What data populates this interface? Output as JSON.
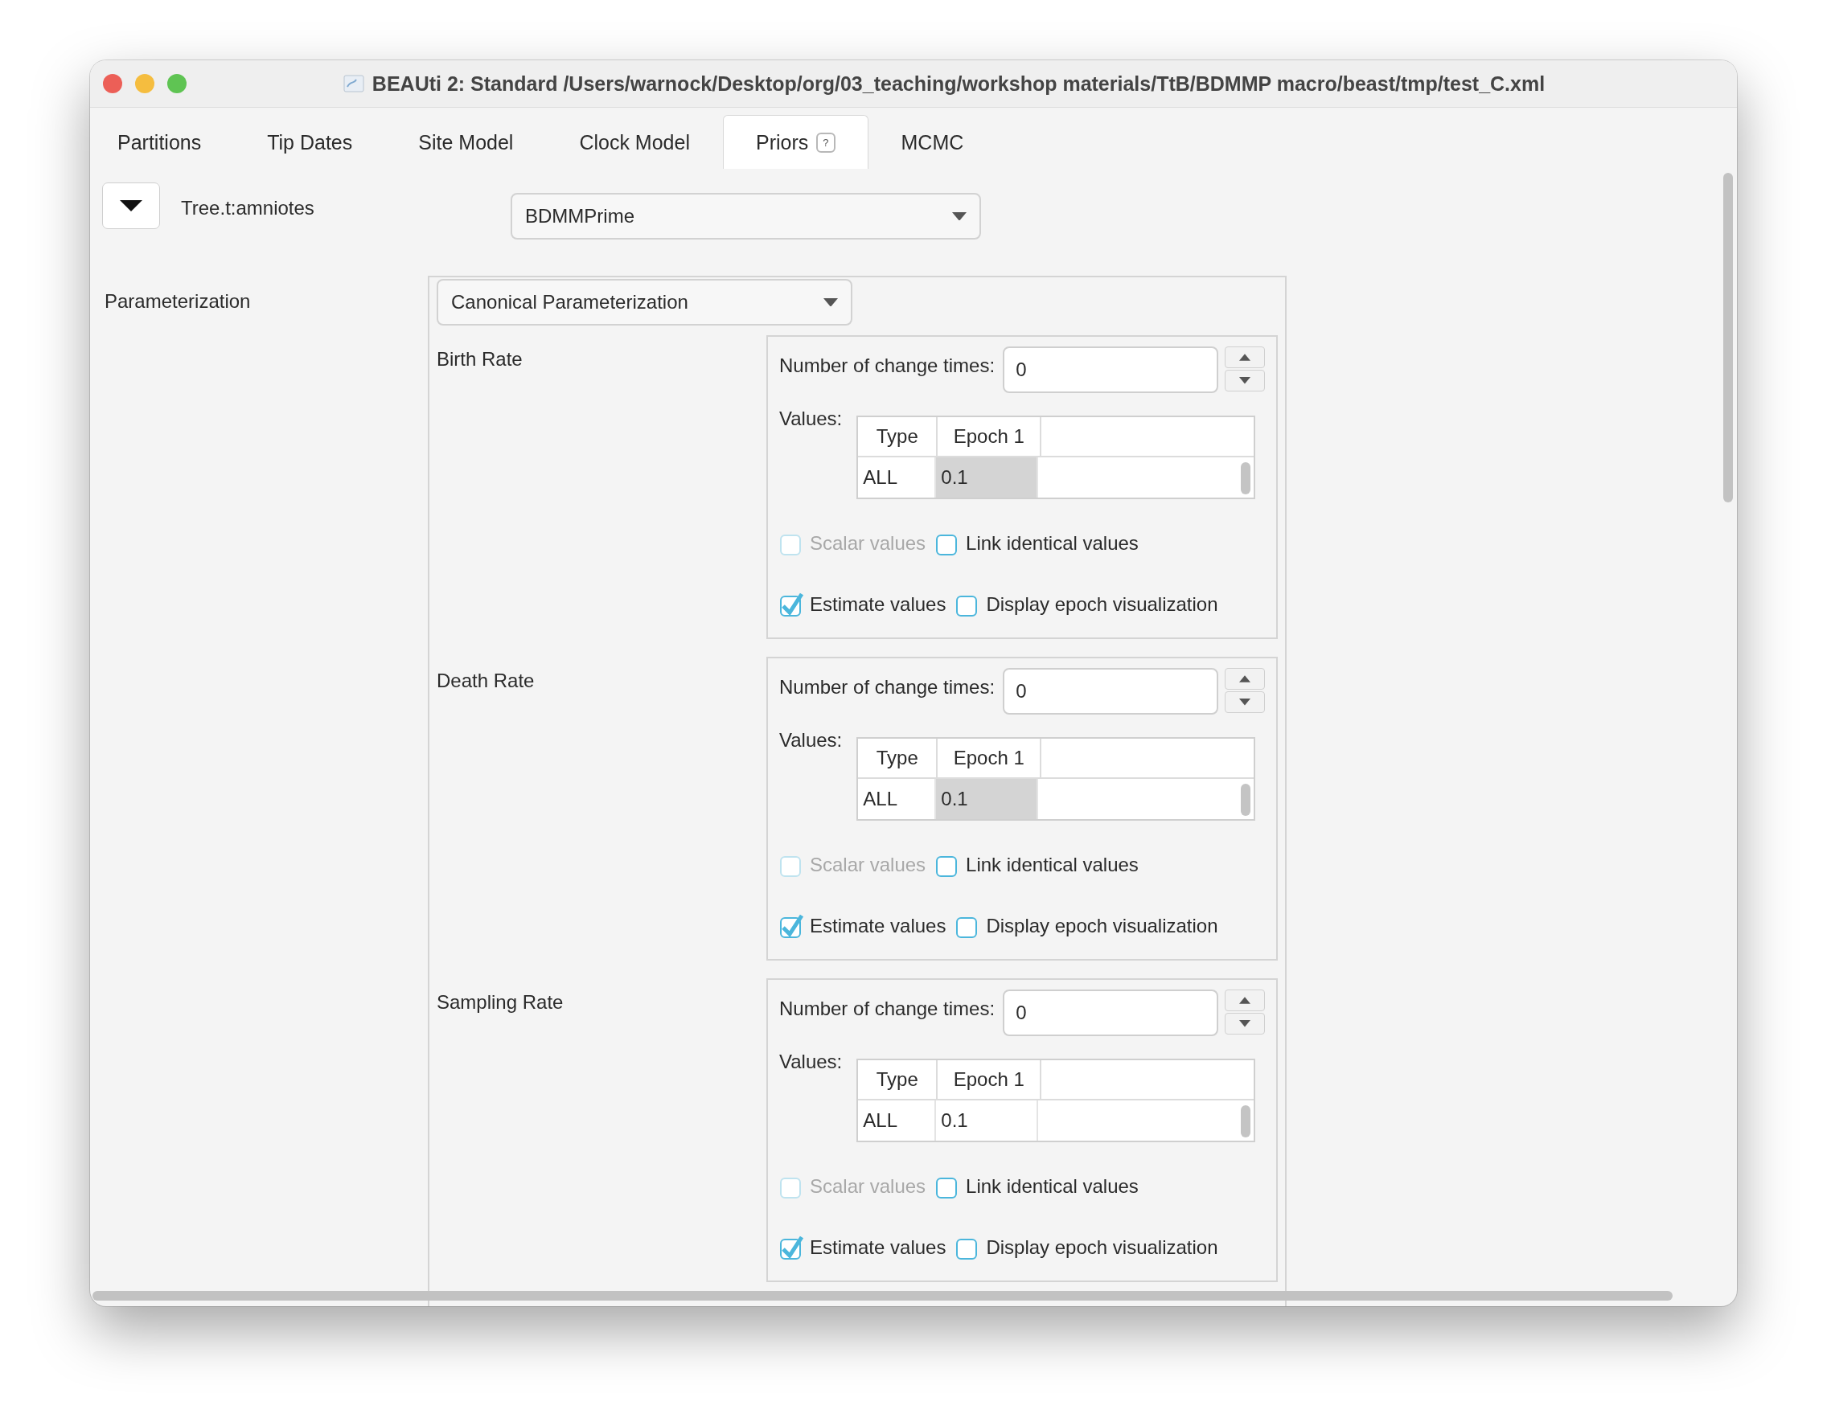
{
  "window": {
    "title": "BEAUti 2: Standard /Users/warnock/Desktop/org/03_teaching/workshop materials/TtB/BDMMP macro/beast/tmp/test_C.xml"
  },
  "tabs": [
    {
      "label": "Partitions",
      "selected": false
    },
    {
      "label": "Tip Dates",
      "selected": false
    },
    {
      "label": "Site Model",
      "selected": false
    },
    {
      "label": "Clock Model",
      "selected": false
    },
    {
      "label": "Priors",
      "selected": true,
      "help": "?"
    },
    {
      "label": "MCMC",
      "selected": false
    }
  ],
  "tree": {
    "expanded": true,
    "label": "Tree.t:amniotes",
    "model": "BDMMPrime"
  },
  "parameterization": {
    "label": "Parameterization",
    "value": "Canonical Parameterization"
  },
  "rates": [
    {
      "name": "Birth Rate",
      "change_times_label": "Number of change times:",
      "change_times": "0",
      "values_label": "Values:",
      "columns": [
        "Type",
        "Epoch 1"
      ],
      "rows": [
        [
          {
            "text": "ALL",
            "selected": false
          },
          {
            "text": "0.1",
            "selected": true
          }
        ]
      ],
      "options": [
        [
          {
            "label": "Scalar values",
            "checked": false,
            "disabled": true
          },
          {
            "label": "Link identical values",
            "checked": false,
            "disabled": false
          }
        ],
        [
          {
            "label": "Estimate values",
            "checked": true,
            "disabled": false
          },
          {
            "label": "Display epoch visualization",
            "checked": false,
            "disabled": false
          }
        ]
      ]
    },
    {
      "name": "Death Rate",
      "change_times_label": "Number of change times:",
      "change_times": "0",
      "values_label": "Values:",
      "columns": [
        "Type",
        "Epoch 1"
      ],
      "rows": [
        [
          {
            "text": "ALL",
            "selected": false
          },
          {
            "text": "0.1",
            "selected": true
          }
        ]
      ],
      "options": [
        [
          {
            "label": "Scalar values",
            "checked": false,
            "disabled": true
          },
          {
            "label": "Link identical values",
            "checked": false,
            "disabled": false
          }
        ],
        [
          {
            "label": "Estimate values",
            "checked": true,
            "disabled": false
          },
          {
            "label": "Display epoch visualization",
            "checked": false,
            "disabled": false
          }
        ]
      ]
    },
    {
      "name": "Sampling Rate",
      "change_times_label": "Number of change times:",
      "change_times": "0",
      "values_label": "Values:",
      "columns": [
        "Type",
        "Epoch 1"
      ],
      "rows": [
        [
          {
            "text": "ALL",
            "selected": false
          },
          {
            "text": "0.1",
            "selected": false
          }
        ]
      ],
      "options": [
        [
          {
            "label": "Scalar values",
            "checked": false,
            "disabled": true
          },
          {
            "label": "Link identical values",
            "checked": false,
            "disabled": false
          }
        ],
        [
          {
            "label": "Estimate values",
            "checked": true,
            "disabled": false
          },
          {
            "label": "Display epoch visualization",
            "checked": false,
            "disabled": false
          }
        ]
      ]
    }
  ]
}
